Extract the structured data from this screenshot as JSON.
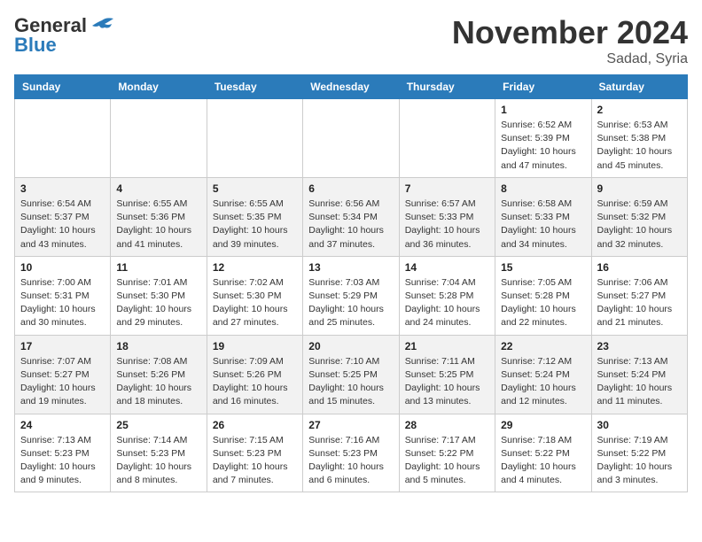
{
  "header": {
    "logo_general": "General",
    "logo_blue": "Blue",
    "month_title": "November 2024",
    "location": "Sadad, Syria"
  },
  "columns": [
    "Sunday",
    "Monday",
    "Tuesday",
    "Wednesday",
    "Thursday",
    "Friday",
    "Saturday"
  ],
  "weeks": [
    [
      {
        "day": "",
        "info": ""
      },
      {
        "day": "",
        "info": ""
      },
      {
        "day": "",
        "info": ""
      },
      {
        "day": "",
        "info": ""
      },
      {
        "day": "",
        "info": ""
      },
      {
        "day": "1",
        "info": "Sunrise: 6:52 AM\nSunset: 5:39 PM\nDaylight: 10 hours\nand 47 minutes."
      },
      {
        "day": "2",
        "info": "Sunrise: 6:53 AM\nSunset: 5:38 PM\nDaylight: 10 hours\nand 45 minutes."
      }
    ],
    [
      {
        "day": "3",
        "info": "Sunrise: 6:54 AM\nSunset: 5:37 PM\nDaylight: 10 hours\nand 43 minutes."
      },
      {
        "day": "4",
        "info": "Sunrise: 6:55 AM\nSunset: 5:36 PM\nDaylight: 10 hours\nand 41 minutes."
      },
      {
        "day": "5",
        "info": "Sunrise: 6:55 AM\nSunset: 5:35 PM\nDaylight: 10 hours\nand 39 minutes."
      },
      {
        "day": "6",
        "info": "Sunrise: 6:56 AM\nSunset: 5:34 PM\nDaylight: 10 hours\nand 37 minutes."
      },
      {
        "day": "7",
        "info": "Sunrise: 6:57 AM\nSunset: 5:33 PM\nDaylight: 10 hours\nand 36 minutes."
      },
      {
        "day": "8",
        "info": "Sunrise: 6:58 AM\nSunset: 5:33 PM\nDaylight: 10 hours\nand 34 minutes."
      },
      {
        "day": "9",
        "info": "Sunrise: 6:59 AM\nSunset: 5:32 PM\nDaylight: 10 hours\nand 32 minutes."
      }
    ],
    [
      {
        "day": "10",
        "info": "Sunrise: 7:00 AM\nSunset: 5:31 PM\nDaylight: 10 hours\nand 30 minutes."
      },
      {
        "day": "11",
        "info": "Sunrise: 7:01 AM\nSunset: 5:30 PM\nDaylight: 10 hours\nand 29 minutes."
      },
      {
        "day": "12",
        "info": "Sunrise: 7:02 AM\nSunset: 5:30 PM\nDaylight: 10 hours\nand 27 minutes."
      },
      {
        "day": "13",
        "info": "Sunrise: 7:03 AM\nSunset: 5:29 PM\nDaylight: 10 hours\nand 25 minutes."
      },
      {
        "day": "14",
        "info": "Sunrise: 7:04 AM\nSunset: 5:28 PM\nDaylight: 10 hours\nand 24 minutes."
      },
      {
        "day": "15",
        "info": "Sunrise: 7:05 AM\nSunset: 5:28 PM\nDaylight: 10 hours\nand 22 minutes."
      },
      {
        "day": "16",
        "info": "Sunrise: 7:06 AM\nSunset: 5:27 PM\nDaylight: 10 hours\nand 21 minutes."
      }
    ],
    [
      {
        "day": "17",
        "info": "Sunrise: 7:07 AM\nSunset: 5:27 PM\nDaylight: 10 hours\nand 19 minutes."
      },
      {
        "day": "18",
        "info": "Sunrise: 7:08 AM\nSunset: 5:26 PM\nDaylight: 10 hours\nand 18 minutes."
      },
      {
        "day": "19",
        "info": "Sunrise: 7:09 AM\nSunset: 5:26 PM\nDaylight: 10 hours\nand 16 minutes."
      },
      {
        "day": "20",
        "info": "Sunrise: 7:10 AM\nSunset: 5:25 PM\nDaylight: 10 hours\nand 15 minutes."
      },
      {
        "day": "21",
        "info": "Sunrise: 7:11 AM\nSunset: 5:25 PM\nDaylight: 10 hours\nand 13 minutes."
      },
      {
        "day": "22",
        "info": "Sunrise: 7:12 AM\nSunset: 5:24 PM\nDaylight: 10 hours\nand 12 minutes."
      },
      {
        "day": "23",
        "info": "Sunrise: 7:13 AM\nSunset: 5:24 PM\nDaylight: 10 hours\nand 11 minutes."
      }
    ],
    [
      {
        "day": "24",
        "info": "Sunrise: 7:13 AM\nSunset: 5:23 PM\nDaylight: 10 hours\nand 9 minutes."
      },
      {
        "day": "25",
        "info": "Sunrise: 7:14 AM\nSunset: 5:23 PM\nDaylight: 10 hours\nand 8 minutes."
      },
      {
        "day": "26",
        "info": "Sunrise: 7:15 AM\nSunset: 5:23 PM\nDaylight: 10 hours\nand 7 minutes."
      },
      {
        "day": "27",
        "info": "Sunrise: 7:16 AM\nSunset: 5:23 PM\nDaylight: 10 hours\nand 6 minutes."
      },
      {
        "day": "28",
        "info": "Sunrise: 7:17 AM\nSunset: 5:22 PM\nDaylight: 10 hours\nand 5 minutes."
      },
      {
        "day": "29",
        "info": "Sunrise: 7:18 AM\nSunset: 5:22 PM\nDaylight: 10 hours\nand 4 minutes."
      },
      {
        "day": "30",
        "info": "Sunrise: 7:19 AM\nSunset: 5:22 PM\nDaylight: 10 hours\nand 3 minutes."
      }
    ]
  ]
}
